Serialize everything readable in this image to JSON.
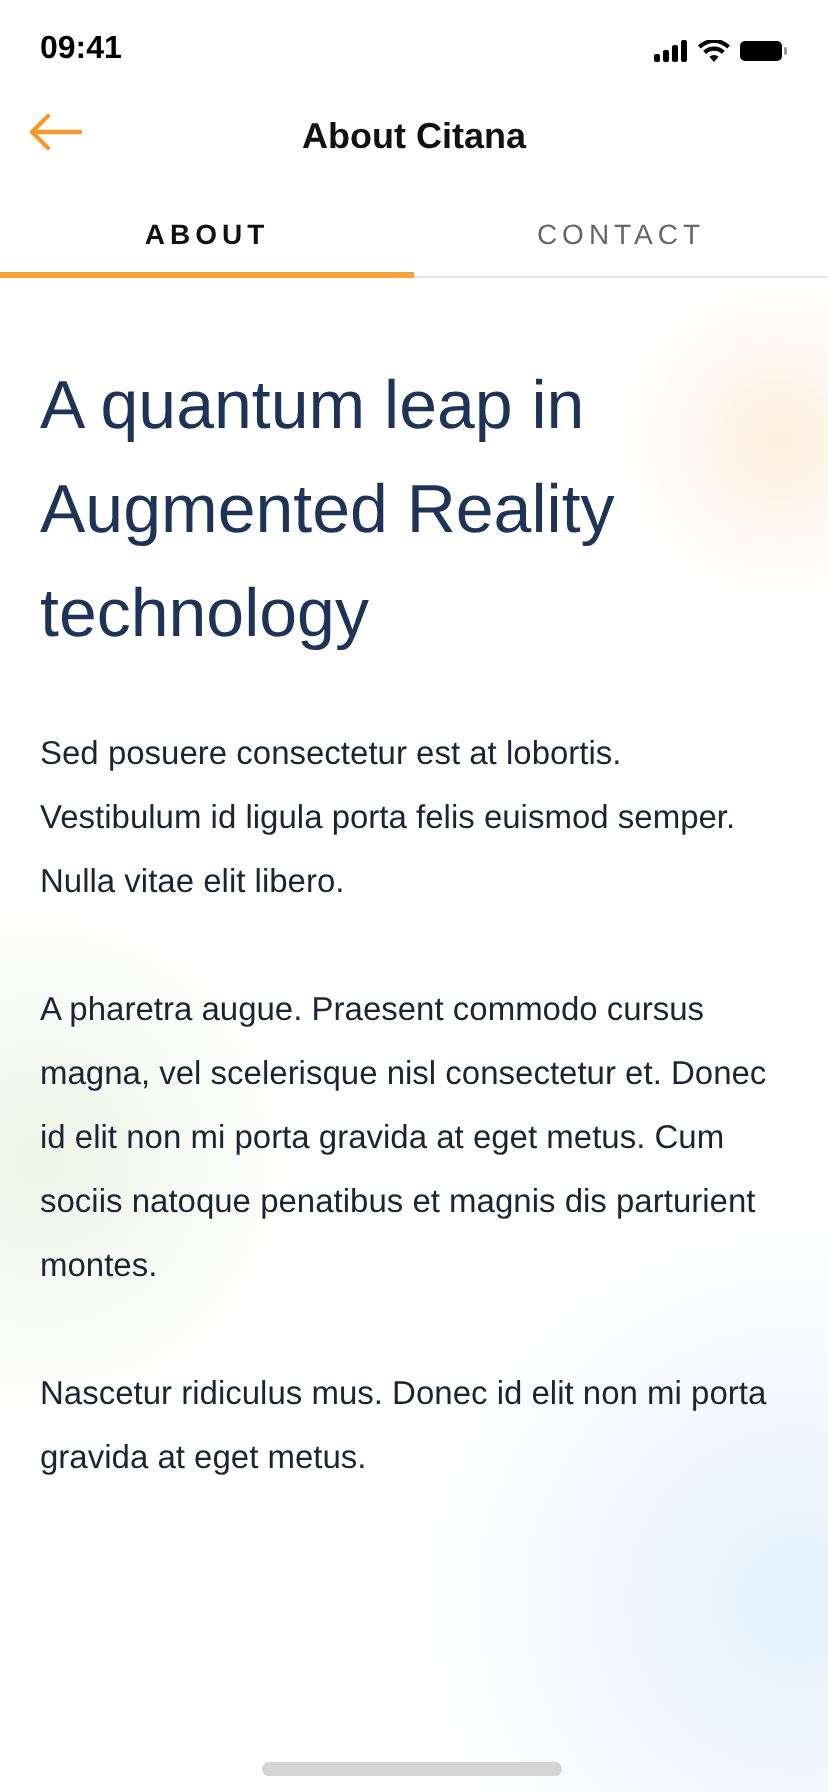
{
  "status_bar": {
    "time": "09:41"
  },
  "header": {
    "title": "About Citana"
  },
  "tabs": [
    {
      "label": "ABOUT",
      "selected": true
    },
    {
      "label": "CONTACT",
      "selected": false
    }
  ],
  "article": {
    "heading": "A quantum leap in Augmented Reality technology",
    "paragraphs": [
      "Sed posuere consectetur est at lobortis. Vestibulum id ligula porta felis euismod semper. Nulla vitae elit libero.",
      "A pharetra augue. Praesent commodo cursus magna, vel scelerisque nisl consectetur et. Donec id elit non mi porta gravida at eget metus. Cum sociis natoque penatibus et magnis dis parturient montes.",
      "Nascetur ridiculus mus. Donec id elit non mi porta gravida at eget metus."
    ]
  }
}
